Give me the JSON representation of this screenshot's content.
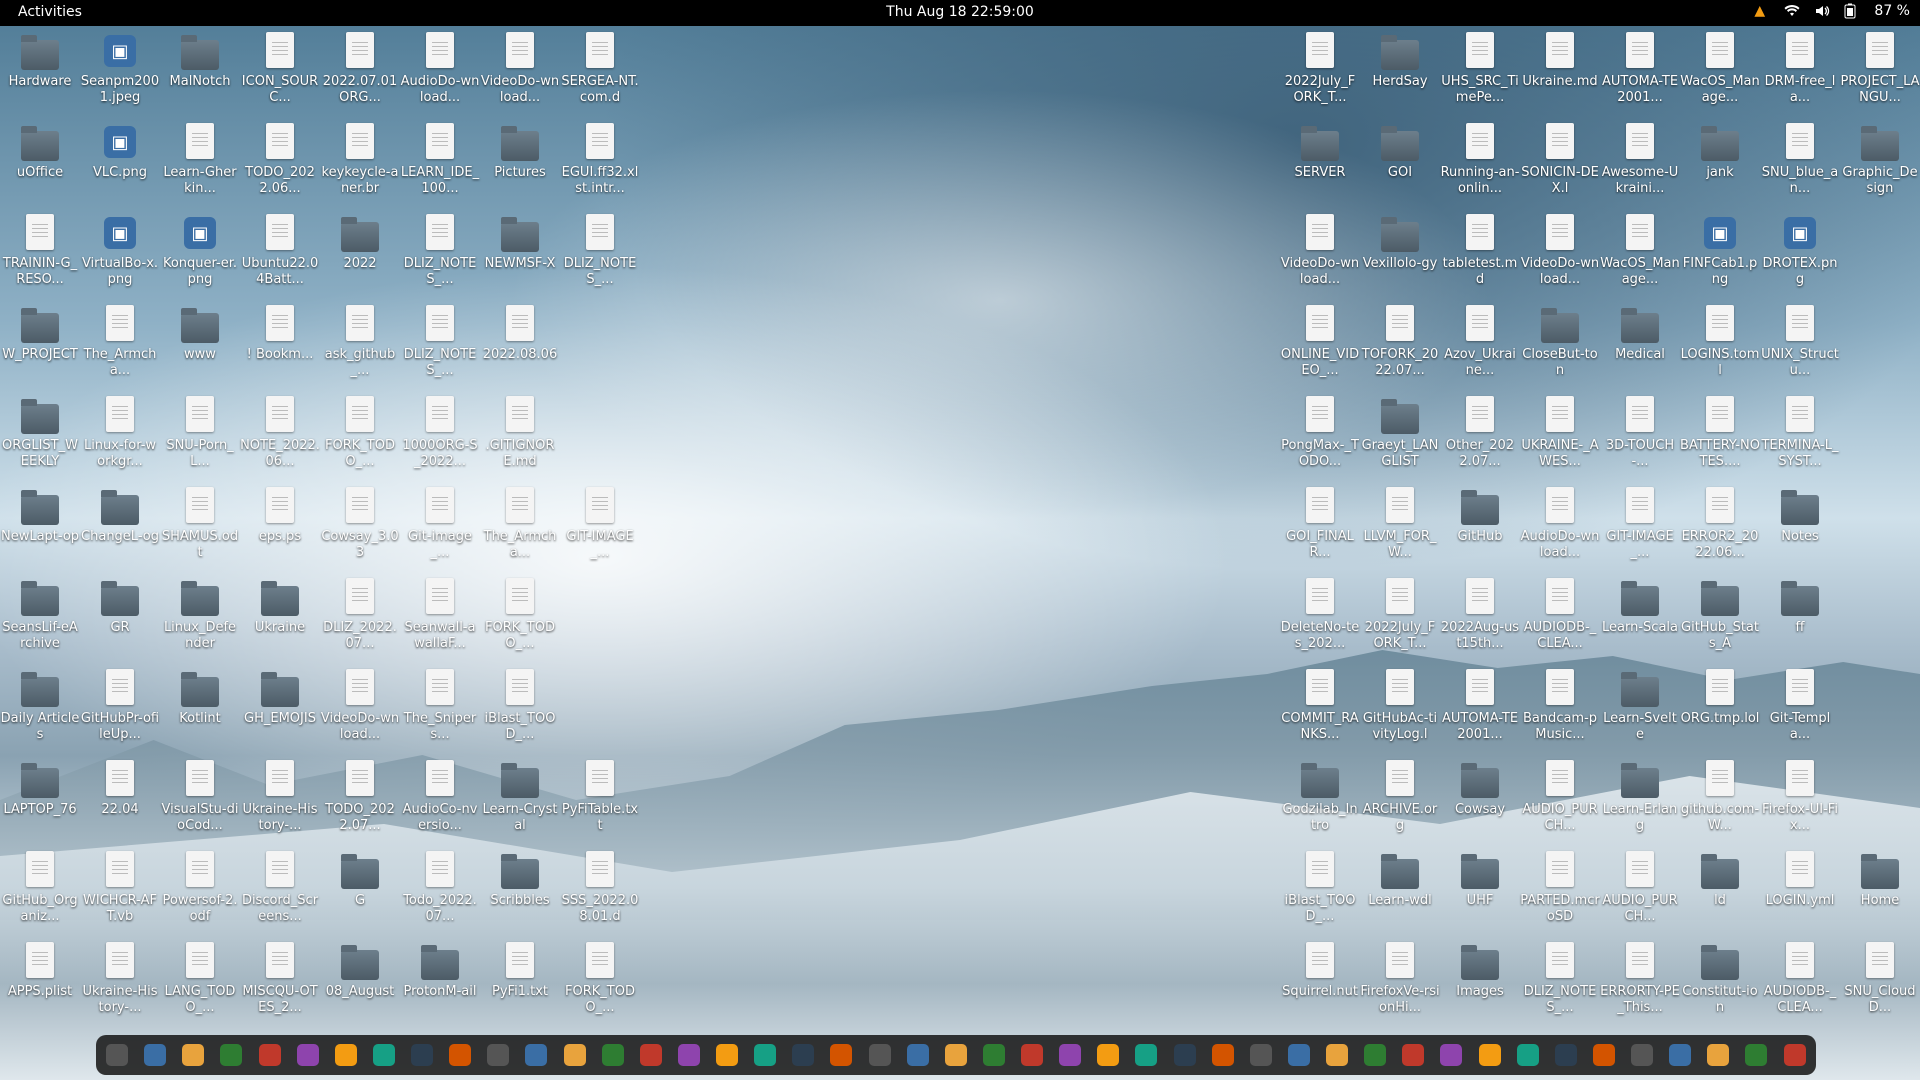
{
  "topbar": {
    "activities": "Activities",
    "clock": "Thu Aug 18  22:59:00",
    "battery": "87 %",
    "icons": [
      "vlc-icon",
      "wifi-icon",
      "volume-icon",
      "battery-icon"
    ]
  },
  "desktop": {
    "left_columns": [
      [
        "Hardware",
        "uOffice",
        "TRAININ-G_RESO...",
        "W_PROJECT",
        "ORGLIST_WEEKLY",
        "NewLapt-op",
        "SeansLif-eArchive",
        "Daily Articles",
        "LAPTOP_76",
        "GitHub_Organiz...",
        "APPS.plist"
      ],
      [
        "Seanpm2001.jpeg",
        "VLC.png",
        "VirtualBo-x.png",
        "The_Armcha...",
        "Linux-for-workgr...",
        "ChangeL-og",
        "GR",
        "GitHubPr-ofileUp...",
        "22.04",
        "WICHCR-AFT.vb",
        "Ukraine-History-..."
      ],
      [
        "MalNotch",
        "Learn-Gherkin...",
        "Konquer-er.png",
        "www",
        "SNU-Porn_L...",
        "SHAMUS.odt",
        "Linux_Defender",
        "Kotlint",
        "VisualStu-dioCod...",
        "Powersof-2.odf",
        "LANG_TODO_..."
      ],
      [
        "ICON_SOURC...",
        "TODO_2022.06...",
        "Ubuntu22.04Batt...",
        "! Bookm...",
        "NOTE_2022.06...",
        "eps.ps",
        "Ukraine",
        "GH_EMOJIS",
        "Ukraine-History-...",
        "Discord_Screens...",
        "MISCQU-OTES_2..."
      ],
      [
        "2022.07.01ORG...",
        "keykeycle-aner.br",
        "2022",
        "ask_github_...",
        "FORK_TODO_...",
        "Cowsay_3.03",
        "DLIZ_2022.07...",
        "VideoDo-wnload...",
        "TODO_2022.07...",
        "G",
        "08_August"
      ],
      [
        "AudioDo-wnload...",
        "LEARN_IDE_100...",
        "DLIZ_NOTES_...",
        "DLIZ_NOTES_...",
        "1000ORG-S_2022...",
        "Git-image_...",
        "Seanwall-awallaF...",
        "The_Snipers...",
        "AudioCo-nversio...",
        "Todo_2022.07...",
        "ProtonM-ail"
      ],
      [
        "VideoDo-wnload...",
        "Pictures",
        "NEWMSF-X",
        "2022.08.06",
        ".GITIGNORE.md",
        "The_Armcha...",
        "FORK_TODO_...",
        "iBlast_TOOD_...",
        "Learn-Crystal",
        "Scribbles",
        "PyFi1.txt"
      ],
      [
        "SERGEA-NT.com.d",
        "EGUI.ff32.xlst.intr...",
        "DLIZ_NOTES_...",
        "",
        "",
        "GIT-IMAGE_...",
        "",
        "",
        "PyFiTable.txt",
        "SSS_2022.08.01.d",
        "FORK_TODO_..."
      ]
    ],
    "right_columns": [
      [
        "2022July_FORK_T...",
        "SERVER",
        "VideoDo-wnload...",
        "ONLINE_VIDEO_...",
        "PongMax-_TODO...",
        "GOI_FINALR...",
        "DeleteNo-tes_202...",
        "COMMIT_RANKS...",
        "Godzilab_Intro",
        "iBlast_TOOD_...",
        "Squirrel.nut"
      ],
      [
        "HerdSay",
        "GOI",
        "Vexillolo-gy",
        "TOFORK_2022.07...",
        "Graeyt_LANGLIST",
        "LLVM_FOR_W...",
        "2022July_FORK_T...",
        "GitHubAc-tivityLog.l",
        "ARCHIVE.org",
        "Learn-wdl",
        "FirefoxVe-rsionHi..."
      ],
      [
        "UHS_SRC_TimePe...",
        "Running-an-onlin...",
        "tabletest.md",
        "Azov_Ukraine...",
        "Other_2022.07...",
        "GitHub",
        "2022Aug-ust15th...",
        "AUTOMA-TE2001...",
        "Cowsay",
        "UHF",
        "Images"
      ],
      [
        "Ukraine.md",
        "SONICIN-DEX.l",
        "VideoDo-wnload...",
        "CloseBut-ton",
        "UKRAINE-_AWES...",
        "AudioDo-wnload...",
        "AUDIODB-_CLEA...",
        "Bandcam-pMusic...",
        "AUDIO_PURCH...",
        "PARTED.mcroSD",
        "DLIZ_NOTES_..."
      ],
      [
        "AUTOMA-TE2001...",
        "Awesome-Ukraini...",
        "WacOS_Manage...",
        "Medical",
        "3D-TOUCH-...",
        "GIT-IMAGE_...",
        "Learn-Scala",
        "Learn-Svelte",
        "Learn-Erlang",
        "AUDIO_PURCH...",
        "ERRORTY-PE_This..."
      ],
      [
        "WacOS_Manage...",
        "jank",
        "FINFCab1.png",
        "LOGINS.toml",
        "BATTERY-NOTES....",
        "ERROR2_2022.06...",
        "GitHub_Stats_A",
        "ORG.tmp.lol",
        "github.com-W...",
        "ld",
        "Constitut-ion"
      ],
      [
        "DRM-free_la...",
        "SNU_blue_an...",
        "DROTEX.png",
        "UNIX_Structu...",
        "TERMINA-L_SYST...",
        "Notes",
        "ff",
        "Git-Templa...",
        "Firefox-UI-Fix...",
        "LOGIN.yml",
        "AUDIODB-_CLEA..."
      ],
      [
        "PROJECT_LANGU...",
        "Graphic_Design",
        "",
        "",
        "",
        "",
        "",
        "",
        "",
        "Home",
        "SNU_CloudD..."
      ]
    ]
  },
  "dock": {
    "apps": [
      "terminal",
      "files",
      "chrome",
      "gedit",
      "text-editor",
      "screenshot",
      "libreoffice-writer",
      "notes",
      "editor",
      "terminal-2",
      "firefox",
      "vlc",
      "obs",
      "software",
      "writer",
      "help",
      "monitor",
      "dot",
      "terminal-3",
      "inkscape",
      "virtualbox",
      "camera",
      "calc",
      "docs",
      "pdf",
      "printer",
      "discord",
      "telegram",
      "steam",
      "acrobat",
      "gimp",
      "app-1",
      "app-2",
      "vscode",
      "github",
      "app-3",
      "app-4",
      "app-5",
      "cube",
      "app-6",
      "app-7",
      "app-8",
      "app-9",
      "app-10",
      "grid"
    ]
  },
  "colors": {
    "topbar": "#000000",
    "dock": "#1e1e1e",
    "label_text": "#ffffff"
  }
}
